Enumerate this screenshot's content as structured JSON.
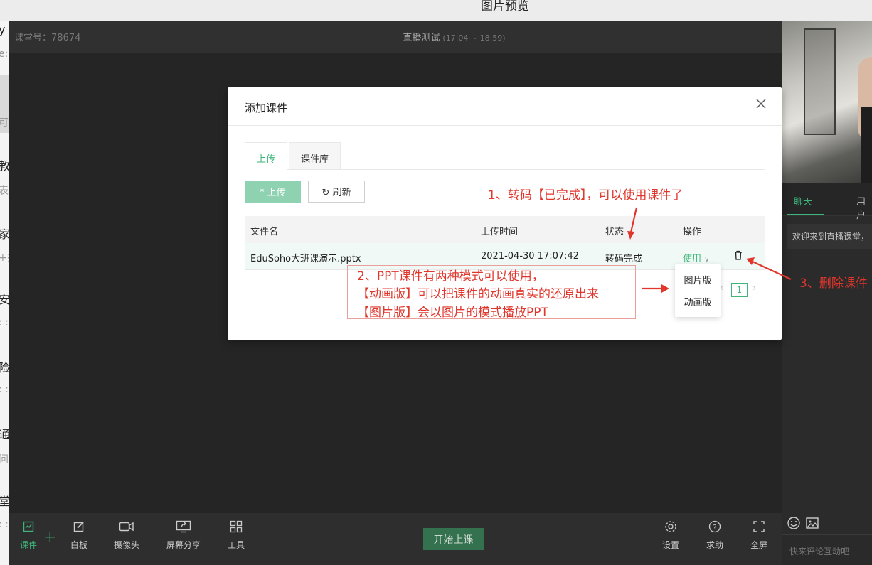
{
  "window": {
    "title": "图片预览"
  },
  "left_strip": {
    "fragments": [
      "y",
      "e:",
      "可",
      "教",
      "表",
      "家",
      "+扌",
      "安",
      ": :",
      "险",
      ": :",
      "通",
      "问",
      "堂",
      ": :"
    ]
  },
  "top_bar": {
    "room_id": "课堂号：78674",
    "title": "直播测试",
    "time": "(17:04 ~ 18:59)"
  },
  "modal": {
    "title": "添加课件",
    "tabs": [
      {
        "label": "上传",
        "active": true
      },
      {
        "label": "课件库",
        "active": false
      }
    ],
    "upload_button": "上传",
    "refresh_button": "刷新",
    "table": {
      "headers": [
        "文件名",
        "上传时间",
        "状态",
        "操作"
      ],
      "rows": [
        {
          "filename": "EduSoho大班课演示.pptx",
          "upload_time": "2021-04-30 17:07:42",
          "status": "转码完成",
          "action": "使用"
        }
      ]
    },
    "use_dropdown": {
      "options": [
        "图片版",
        "动画版"
      ]
    },
    "pagination": {
      "current_page": "1"
    }
  },
  "annotations": {
    "note1": "1、转码【已完成】，可以使用课件了",
    "note2": [
      "2、PPT课件有两种模式可以使用，",
      "【动画版】可以把课件的动画真实的还原出来",
      "【图片版】会以图片的模式播放PPT"
    ],
    "note3": "3、删除课件"
  },
  "bottom_toolbar": {
    "items": [
      {
        "label": "课件",
        "icon": "courseware-icon",
        "active": true
      },
      {
        "label": "白板",
        "icon": "whiteboard-icon"
      },
      {
        "label": "摄像头",
        "icon": "camera-icon"
      },
      {
        "label": "屏幕分享",
        "icon": "screen-share-icon"
      },
      {
        "label": "工具",
        "icon": "tools-icon"
      }
    ],
    "start_button": "开始上课",
    "right_items": [
      {
        "label": "设置",
        "icon": "settings-icon"
      },
      {
        "label": "求助",
        "icon": "help-icon"
      },
      {
        "label": "全屏",
        "icon": "fullscreen-icon"
      }
    ]
  },
  "right_panel": {
    "tabs": [
      "聊天",
      "用户"
    ],
    "welcome": "欢迎来到直播课堂，",
    "chat_placeholder": "快来评论互动吧"
  },
  "colors": {
    "accent": "#3eb57a",
    "annotation": "#e0362c"
  }
}
